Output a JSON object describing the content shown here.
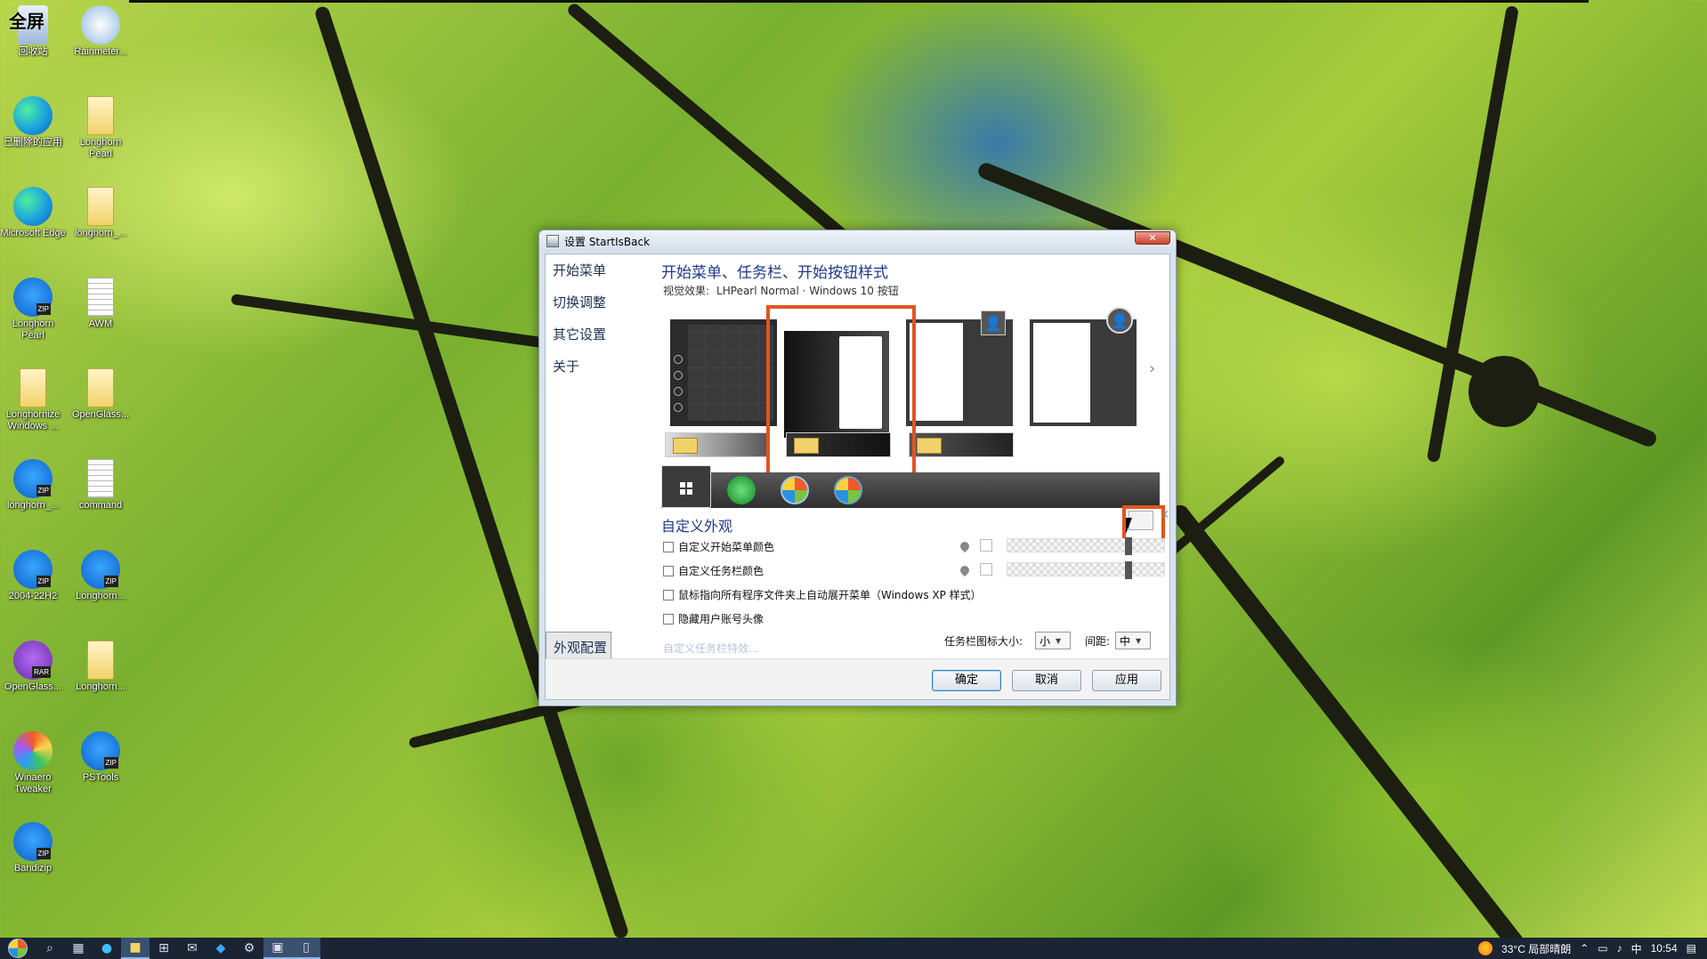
{
  "desktop": {
    "icons": [
      {
        "label": "回收站",
        "icon": "recycle-bin-icon"
      },
      {
        "label": "Rainmeter...",
        "icon": "rainmeter-icon"
      },
      {
        "label": "已删除的应用",
        "icon": "edge-icon"
      },
      {
        "label": "Longhorn Pearl",
        "icon": "folder-icon"
      },
      {
        "label": "Microsoft Edge",
        "icon": "edge-icon"
      },
      {
        "label": "longhorn_...",
        "icon": "folder-icon"
      },
      {
        "label": "Longhorn Pearl",
        "icon": "zip-icon"
      },
      {
        "label": "AWM",
        "icon": "document-icon"
      },
      {
        "label": "Longhornize Windows ...",
        "icon": "folder-icon"
      },
      {
        "label": "OpenGlass...",
        "icon": "folder-icon"
      },
      {
        "label": "longhorn_...",
        "icon": "zip-icon"
      },
      {
        "label": "command",
        "icon": "document-icon"
      },
      {
        "label": "2004-22H2",
        "icon": "zip-icon"
      },
      {
        "label": "Longhorn...",
        "icon": "zip-icon"
      },
      {
        "label": "OpenGlass...",
        "icon": "rar-icon"
      },
      {
        "label": "Longhorn...",
        "icon": "folder-icon"
      },
      {
        "label": "Winaero Tweaker",
        "icon": "winaero-icon"
      },
      {
        "label": "PSTools",
        "icon": "zip-icon"
      },
      {
        "label": "Bandizip",
        "icon": "bandizip-icon"
      }
    ],
    "overlay_text": "全屏"
  },
  "dialog": {
    "title": "设置 StartIsBack",
    "close_label": "✕",
    "nav": [
      "开始菜单",
      "外观配置",
      "切换调整",
      "其它设置",
      "关于"
    ],
    "selected_nav": 1,
    "header": "开始菜单、任务栏、开始按钮样式",
    "visual_effect_label": "视觉效果:",
    "visual_effect_value": "LHPearl Normal · Windows 10 按钮",
    "custom_section": "自定义外观",
    "options": [
      "自定义开始菜单颜色",
      "自定义任务栏颜色",
      "鼠标指向所有程序文件夹上自动展开菜单（Windows XP 样式）",
      "隐藏用户账号头像"
    ],
    "custom_taskbar_link": "自定义任务栏特效...",
    "taskbar_icon_size_label": "任务栏图标大小:",
    "taskbar_icon_size_value": "小",
    "spacing_label": "间距:",
    "spacing_value": "中",
    "buttons": {
      "ok": "确定",
      "cancel": "取消",
      "apply": "应用"
    }
  },
  "taskbar": {
    "weather": "33°C 局部晴朗",
    "ime": "中",
    "time": "10:54"
  }
}
